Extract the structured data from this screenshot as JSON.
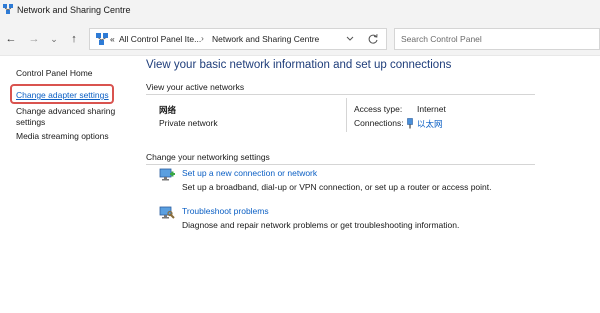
{
  "window": {
    "title": "Network and Sharing Centre"
  },
  "address_bar": {
    "overflow": "«",
    "crumb1": "All Control Panel Ite...",
    "separator": "›",
    "crumb2": "Network and Sharing Centre",
    "dropdown_icon": "chevron-down-icon",
    "refresh_icon": "refresh-icon"
  },
  "nav": {
    "back": "←",
    "forward": "→",
    "recent": "⌄",
    "up": "↑"
  },
  "search": {
    "placeholder": "Search Control Panel"
  },
  "sidebar": {
    "home": "Control Panel Home",
    "adapter": "Change adapter settings",
    "advanced_line1": "Change advanced sharing",
    "advanced_line2": "settings",
    "media": "Media streaming options"
  },
  "main": {
    "title": "View your basic network information and set up connections",
    "active_header": "View your active networks",
    "network_name": "网络",
    "network_type": "Private network",
    "access_label": "Access type:",
    "access_value": "Internet",
    "connections_label": "Connections:",
    "connections_value": "以太网",
    "change_header": "Change your networking settings",
    "tasks": [
      {
        "link": "Set up a new connection or network",
        "desc": "Set up a broadband, dial-up or VPN connection, or set up a router or access point."
      },
      {
        "link": "Troubleshoot problems",
        "desc": "Diagnose and repair network problems or get troubleshooting information."
      }
    ]
  },
  "colors": {
    "link": "#0b5fc4",
    "title": "#1e3d7a",
    "highlight": "#d9534f",
    "chrome": "#f3f3f3"
  }
}
